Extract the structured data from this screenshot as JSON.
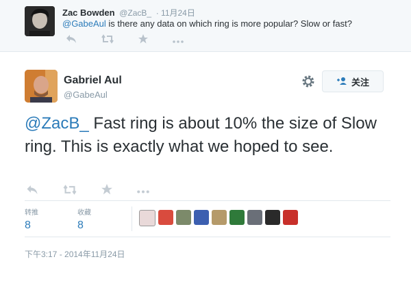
{
  "reply": {
    "name": "Zac Bowden",
    "handle": "@ZacB_",
    "time": "· 11月24日",
    "mention": "@GabeAul",
    "text": " is there any data on which ring is more popular? Slow or fast?",
    "icons": [
      "reply-icon",
      "retweet-icon",
      "favorite-icon",
      "more-icon"
    ]
  },
  "tweet": {
    "name": "Gabriel Aul",
    "handle": "@GabeAul",
    "follow_label": "关注",
    "mention": "@ZacB_",
    "text": " Fast ring is about 10% the size of Slow ring. This is exactly what we hoped to see.",
    "timestamp": "下午3:17 - 2014年11月24日"
  },
  "stats": {
    "retweets_label": "转推",
    "retweets": "8",
    "favorites_label": "收藏",
    "favorites": "8"
  },
  "colors": {
    "link": "#2b7bb9",
    "muted": "#8899a6",
    "text": "#292f33",
    "context_bg": "#f5f8fa"
  }
}
